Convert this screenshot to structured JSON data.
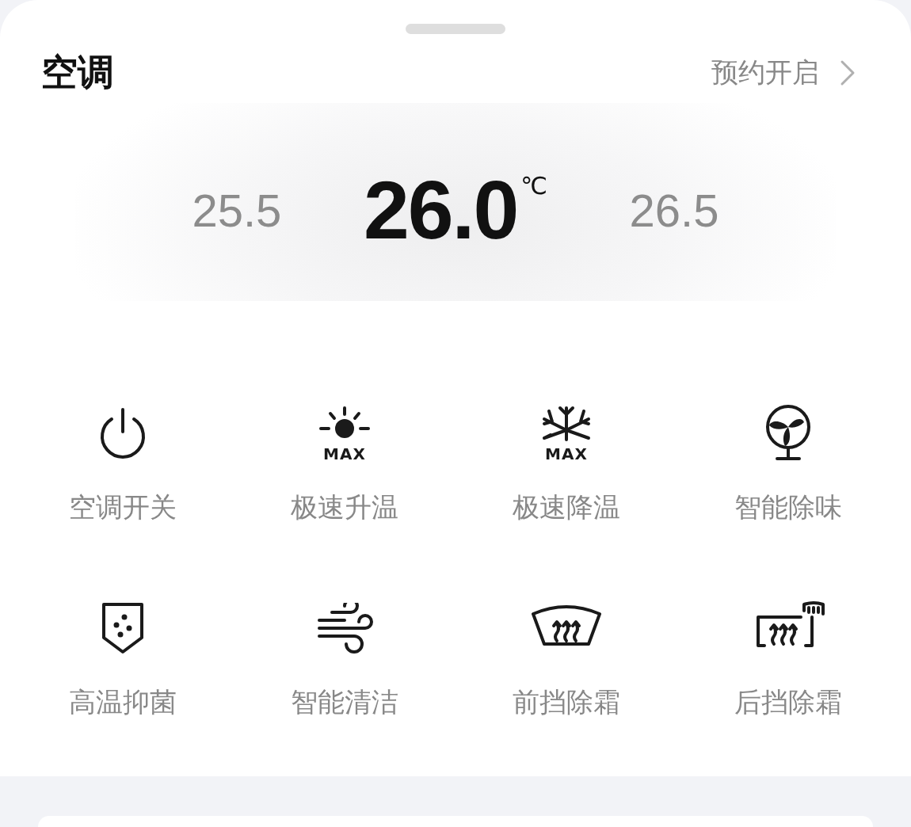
{
  "panel": {
    "title": "空调",
    "schedule": {
      "label": "预约开启"
    }
  },
  "temperatures": [
    {
      "kind": "side",
      "value": "25.5"
    },
    {
      "kind": "current",
      "value": "26.0",
      "unit": "℃"
    },
    {
      "kind": "side",
      "value": "26.5"
    }
  ],
  "functions": [
    {
      "kind": "power",
      "label": "空调开关"
    },
    {
      "kind": "heat",
      "label": "极速升温",
      "badge": "MAX"
    },
    {
      "kind": "cool",
      "label": "极速降温",
      "badge": "MAX"
    },
    {
      "kind": "fan",
      "label": "智能除味"
    },
    {
      "kind": "shield",
      "label": "高温抑菌"
    },
    {
      "kind": "wind",
      "label": "智能清洁"
    },
    {
      "kind": "front-defrost",
      "label": "前挡除霜"
    },
    {
      "kind": "rear-defrost",
      "label": "后挡除霜"
    }
  ]
}
